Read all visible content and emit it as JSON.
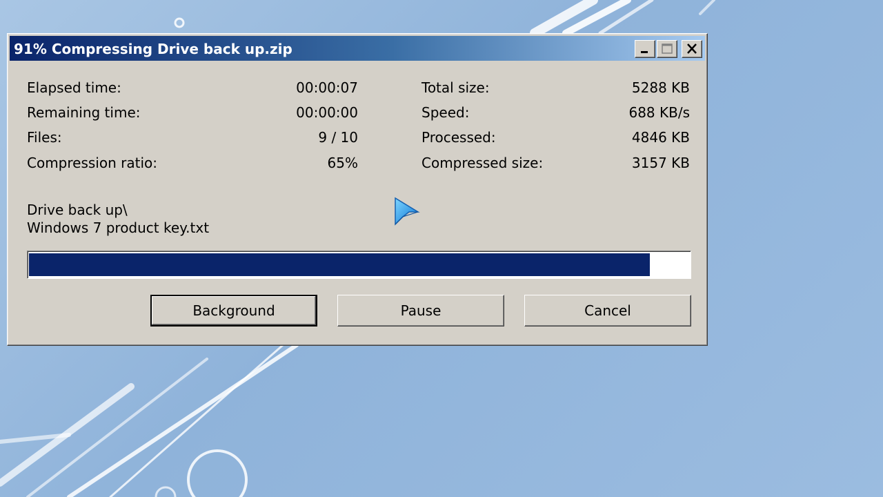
{
  "window": {
    "title": "91% Compressing Drive back up.zip"
  },
  "stats_left": [
    {
      "label": "Elapsed time:",
      "value": "00:00:07"
    },
    {
      "label": "Remaining time:",
      "value": "00:00:00"
    },
    {
      "label": "Files:",
      "value": "9 / 10"
    },
    {
      "label": "Compression ratio:",
      "value": "65%"
    }
  ],
  "stats_right": [
    {
      "label": "Total size:",
      "value": "5288 KB"
    },
    {
      "label": "Speed:",
      "value": "688 KB/s"
    },
    {
      "label": "Processed:",
      "value": "4846 KB"
    },
    {
      "label": "Compressed size:",
      "value": "3157 KB"
    }
  ],
  "current_file": {
    "folder": "Drive back up\\",
    "name": "Windows 7 product key.txt"
  },
  "progress": {
    "percent": 94
  },
  "buttons": {
    "background": "Background",
    "pause": "Pause",
    "cancel": "Cancel"
  },
  "icons": {
    "minimize": "minimize-icon",
    "maximize": "maximize-icon",
    "close": "close-icon",
    "cursor": "pointer-cursor-icon"
  },
  "colors": {
    "progress_fill": "#0a246a",
    "titlebar_start": "#0a246a",
    "titlebar_end": "#a6caf0",
    "dialog_face": "#d4d0c8"
  }
}
